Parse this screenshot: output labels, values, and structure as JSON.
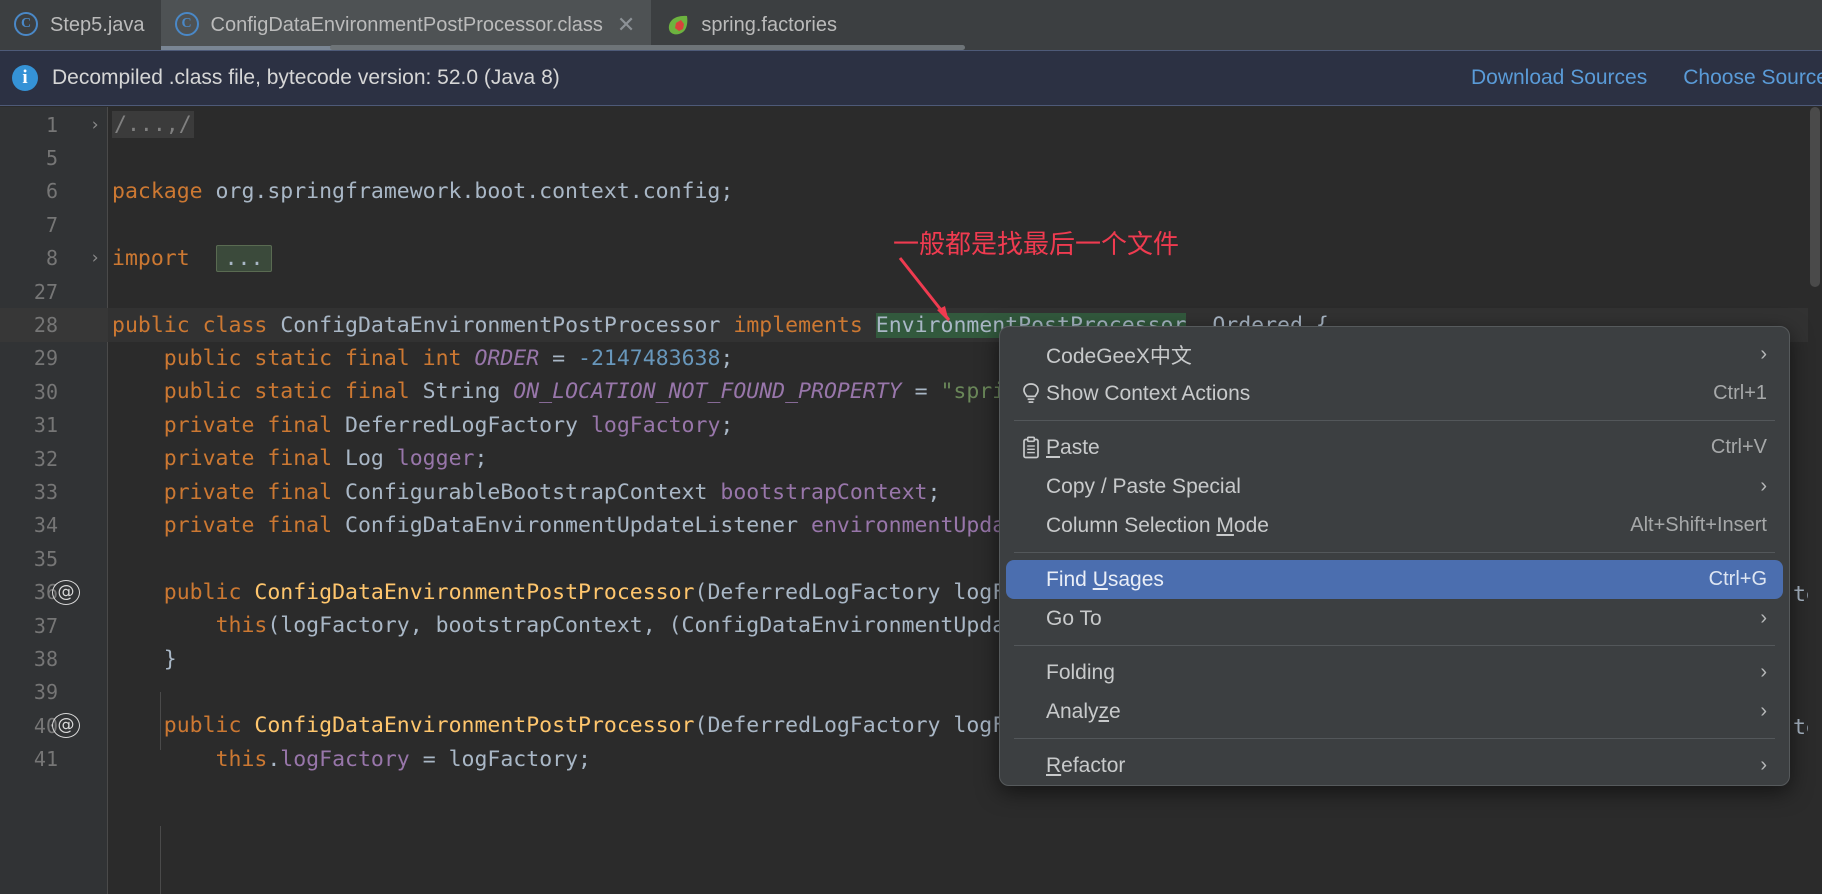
{
  "window": {
    "theme_bg": "#2b2b2b",
    "accent": "#4b6eaf",
    "annotation_color": "#ef3b50"
  },
  "tabs": [
    {
      "label": "Step5.java",
      "icon": "java-class-icon",
      "active": false,
      "closable": false
    },
    {
      "label": "ConfigDataEnvironmentPostProcessor.class",
      "icon": "java-class-icon",
      "active": true,
      "closable": true,
      "close_glyph": "✕"
    },
    {
      "label": "spring.factories",
      "icon": "spring-leaf-icon",
      "active": false,
      "closable": false
    }
  ],
  "banner": {
    "icon": "info-icon",
    "icon_glyph": "i",
    "message": "Decompiled .class file, bytecode version: 52.0 (Java 8)",
    "links": [
      {
        "label": "Download Sources"
      },
      {
        "label": "Choose Sources..."
      }
    ]
  },
  "annotation": {
    "text": "一般都是找最后一个文件"
  },
  "editor": {
    "lines": [
      {
        "num": "1",
        "fold": "›",
        "at": false,
        "highlight": false,
        "segments": [
          {
            "t": "/...,/",
            "c": "cmt",
            "box": "fold"
          }
        ]
      },
      {
        "num": "5",
        "fold": "",
        "at": false,
        "highlight": false,
        "segments": []
      },
      {
        "num": "6",
        "fold": "",
        "at": false,
        "highlight": false,
        "segments": [
          {
            "t": "package",
            "c": "kw"
          },
          {
            "t": " org.springframework.boot.context.config;",
            "c": "pln"
          }
        ]
      },
      {
        "num": "7",
        "fold": "",
        "at": false,
        "highlight": false,
        "segments": []
      },
      {
        "num": "8",
        "fold": "›",
        "at": false,
        "highlight": false,
        "segments": [
          {
            "t": "import",
            "c": "kw"
          },
          {
            "t": "  ",
            "c": "pln"
          },
          {
            "t": "...",
            "c": "pln",
            "box": "foldimp"
          }
        ]
      },
      {
        "num": "27",
        "fold": "",
        "at": false,
        "highlight": false,
        "segments": []
      },
      {
        "num": "28",
        "fold": "",
        "at": false,
        "highlight": true,
        "segments": [
          {
            "t": "public",
            "c": "kw"
          },
          {
            "t": " ",
            "c": "pln"
          },
          {
            "t": "class",
            "c": "kw"
          },
          {
            "t": " ",
            "c": "pln"
          },
          {
            "t": "ConfigDataEnvironmentPostProcessor",
            "c": "typ"
          },
          {
            "t": " ",
            "c": "pln"
          },
          {
            "t": "implements",
            "c": "kw"
          },
          {
            "t": " ",
            "c": "pln"
          },
          {
            "t": "EnvironmentPostProcessor",
            "c": "typ",
            "sel": true
          },
          {
            "t": ", Ordered {",
            "c": "pln"
          }
        ]
      },
      {
        "num": "29",
        "fold": "",
        "at": false,
        "highlight": false,
        "segments": [
          {
            "t": "    ",
            "c": "pln"
          },
          {
            "t": "public static final int",
            "c": "kw"
          },
          {
            "t": " ",
            "c": "pln"
          },
          {
            "t": "ORDER",
            "c": "fld",
            "italic": true
          },
          {
            "t": " = ",
            "c": "pln"
          },
          {
            "t": "-2147483638",
            "c": "num"
          },
          {
            "t": ";",
            "c": "pln"
          }
        ]
      },
      {
        "num": "30",
        "fold": "",
        "at": false,
        "highlight": false,
        "segments": [
          {
            "t": "    ",
            "c": "pln"
          },
          {
            "t": "public static final",
            "c": "kw"
          },
          {
            "t": " String ",
            "c": "pln"
          },
          {
            "t": "ON_LOCATION_NOT_FOUND_PROPERTY",
            "c": "fld",
            "italic": true
          },
          {
            "t": " = ",
            "c": "pln"
          },
          {
            "t": "\"spring.co",
            "c": "str"
          }
        ]
      },
      {
        "num": "31",
        "fold": "",
        "at": false,
        "highlight": false,
        "segments": [
          {
            "t": "    ",
            "c": "pln"
          },
          {
            "t": "private final",
            "c": "kw"
          },
          {
            "t": " DeferredLogFactory ",
            "c": "pln"
          },
          {
            "t": "logFactory",
            "c": "fld"
          },
          {
            "t": ";",
            "c": "pln"
          }
        ]
      },
      {
        "num": "32",
        "fold": "",
        "at": false,
        "highlight": false,
        "segments": [
          {
            "t": "    ",
            "c": "pln"
          },
          {
            "t": "private final",
            "c": "kw"
          },
          {
            "t": " Log ",
            "c": "pln"
          },
          {
            "t": "logger",
            "c": "fld"
          },
          {
            "t": ";",
            "c": "pln"
          }
        ]
      },
      {
        "num": "33",
        "fold": "",
        "at": false,
        "highlight": false,
        "segments": [
          {
            "t": "    ",
            "c": "pln"
          },
          {
            "t": "private final",
            "c": "kw"
          },
          {
            "t": " ConfigurableBootstrapContext ",
            "c": "pln"
          },
          {
            "t": "bootstrapContext",
            "c": "fld"
          },
          {
            "t": ";",
            "c": "pln"
          }
        ]
      },
      {
        "num": "34",
        "fold": "",
        "at": false,
        "highlight": false,
        "segments": [
          {
            "t": "    ",
            "c": "pln"
          },
          {
            "t": "private final",
            "c": "kw"
          },
          {
            "t": " ConfigDataEnvironmentUpdateListener ",
            "c": "pln"
          },
          {
            "t": "environmentUpdateLis",
            "c": "fld"
          }
        ]
      },
      {
        "num": "35",
        "fold": "",
        "at": false,
        "highlight": false,
        "segments": []
      },
      {
        "num": "36",
        "fold": "",
        "at": true,
        "highlight": false,
        "segments": [
          {
            "t": "    ",
            "c": "pln"
          },
          {
            "t": "public",
            "c": "kw"
          },
          {
            "t": " ",
            "c": "pln"
          },
          {
            "t": "ConfigDataEnvironmentPostProcessor",
            "c": "ctor"
          },
          {
            "t": "(DeferredLogFactory logFactor",
            "c": "pln"
          }
        ]
      },
      {
        "num": "37",
        "fold": "",
        "at": false,
        "highlight": false,
        "segments": [
          {
            "t": "        ",
            "c": "pln"
          },
          {
            "t": "this",
            "c": "kw"
          },
          {
            "t": "(logFactory, bootstrapContext, (ConfigDataEnvironmentUpdateLis",
            "c": "pln"
          }
        ]
      },
      {
        "num": "38",
        "fold": "",
        "at": false,
        "highlight": false,
        "segments": [
          {
            "t": "    }",
            "c": "pln"
          }
        ]
      },
      {
        "num": "39",
        "fold": "",
        "at": false,
        "highlight": false,
        "segments": []
      },
      {
        "num": "40",
        "fold": "",
        "at": true,
        "highlight": false,
        "segments": [
          {
            "t": "    ",
            "c": "pln"
          },
          {
            "t": "public",
            "c": "kw"
          },
          {
            "t": " ",
            "c": "pln"
          },
          {
            "t": "ConfigDataEnvironmentPostProcessor",
            "c": "ctor"
          },
          {
            "t": "(DeferredLogFactory logFactor",
            "c": "pln"
          }
        ]
      },
      {
        "num": "41",
        "fold": "",
        "at": false,
        "highlight": false,
        "segments": [
          {
            "t": "        ",
            "c": "pln"
          },
          {
            "t": "this",
            "c": "kw"
          },
          {
            "t": ".",
            "c": "pln"
          },
          {
            "t": "logFactory",
            "c": "fld"
          },
          {
            "t": " = logFactory;",
            "c": "pln"
          }
        ]
      }
    ],
    "occluded_right_text": [
      {
        "line": "36",
        "text": "tex"
      },
      {
        "line": "40",
        "text": "tex"
      }
    ]
  },
  "context_menu": {
    "items": [
      {
        "id": "codegeex",
        "label": "CodeGeeX中文",
        "icon": "",
        "right": "",
        "submenu": true,
        "selected": false,
        "mnemonic": ""
      },
      {
        "id": "show-context-actions",
        "label": "Show Context Actions",
        "icon": "lightbulb-icon",
        "right": "Ctrl+1",
        "submenu": false,
        "selected": false,
        "mnemonic": ""
      },
      {
        "id": "separator-1",
        "separator": true
      },
      {
        "id": "paste",
        "label": "Paste",
        "icon": "clipboard-icon",
        "right": "Ctrl+V",
        "submenu": false,
        "selected": false,
        "mnemonic": "P"
      },
      {
        "id": "copy-paste-special",
        "label": "Copy / Paste Special",
        "icon": "",
        "right": "",
        "submenu": true,
        "selected": false,
        "mnemonic": ""
      },
      {
        "id": "column-selection-mode",
        "label": "Column Selection Mode",
        "icon": "",
        "right": "Alt+Shift+Insert",
        "submenu": false,
        "selected": false,
        "mnemonic": "M"
      },
      {
        "id": "separator-2",
        "separator": true
      },
      {
        "id": "find-usages",
        "label": "Find Usages",
        "icon": "",
        "right": "Ctrl+G",
        "submenu": false,
        "selected": true,
        "mnemonic": "U"
      },
      {
        "id": "go-to",
        "label": "Go To",
        "icon": "",
        "right": "",
        "submenu": true,
        "selected": false,
        "mnemonic": ""
      },
      {
        "id": "separator-3",
        "separator": true
      },
      {
        "id": "folding",
        "label": "Folding",
        "icon": "",
        "right": "",
        "submenu": true,
        "selected": false,
        "mnemonic": ""
      },
      {
        "id": "analyze",
        "label": "Analyze",
        "icon": "",
        "right": "",
        "submenu": true,
        "selected": false,
        "mnemonic": "z"
      },
      {
        "id": "separator-4",
        "separator": true
      },
      {
        "id": "refactor",
        "label": "Refactor",
        "icon": "",
        "right": "",
        "submenu": true,
        "selected": false,
        "mnemonic": "R"
      }
    ],
    "chevron_glyph": "›"
  }
}
